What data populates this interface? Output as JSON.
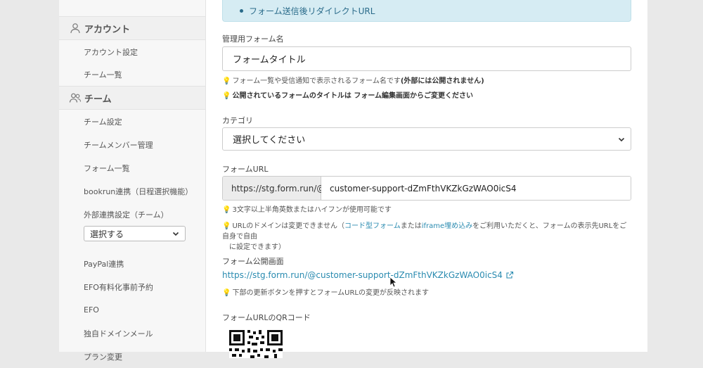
{
  "sidebar": {
    "account_section": "アカウント",
    "account_items": [
      "アカウント設定",
      "チーム一覧"
    ],
    "team_section": "チーム",
    "team_items": [
      "チーム設定",
      "チームメンバー管理",
      "フォーム一覧",
      "bookrun連携（日程選択機能）",
      "外部連携設定（チーム）"
    ],
    "external_select_value": "選択する",
    "more_items": [
      "PayPal連携",
      "EFO有料化事前予約",
      "EFO",
      "独自ドメインメール",
      "プラン変更"
    ]
  },
  "info_box": {
    "item": "フォーム送信後リダイレクトURL"
  },
  "form_name": {
    "label": "管理用フォーム名",
    "value": "フォームタイトル",
    "note1_pre": "フォーム一覧や受信通知で表示されるフォーム名です",
    "note1_bold": "(外部には公開されません)",
    "note2_pre": "公開されているフォームのタイトルは ",
    "note2_link": "フォーム編集画面",
    "note2_post": "からご変更ください"
  },
  "category": {
    "label": "カテゴリ",
    "selected": "選択してください"
  },
  "form_url": {
    "label": "フォームURL",
    "prefix": "https://stg.form.run/@",
    "value": "customer-support-dZmFthVKZkGzWAO0icS4",
    "note1": "3文字以上半角英数またはハイフンが使用可能です",
    "note2_pre": "URLのドメインは変更できません（",
    "note2_link1": "コード型フォーム",
    "note2_mid": "または",
    "note2_link2": "iframe埋め込み",
    "note2_post": "をご利用いただくと、フォームの表示先URLをご自身で自由",
    "note2_line2": "に設定できます）"
  },
  "public_page": {
    "label": "フォーム公開画面",
    "url": "https://stg.form.run/@customer-support-dZmFthVKZkGzWAO0icS4",
    "note": "下部の更新ボタンを押すとフォームURLの変更が反映されます"
  },
  "qr": {
    "label": "フォームURLのQRコード"
  },
  "icons": {
    "account": "user-icon",
    "team": "users-icon",
    "external": "external-link-icon",
    "bulb": "lightbulb-icon",
    "chevron": "chevron-down-icon"
  },
  "colors": {
    "link": "#2a8bb0",
    "info_bg": "#d6ecf3",
    "bulb": "#e6b800"
  }
}
